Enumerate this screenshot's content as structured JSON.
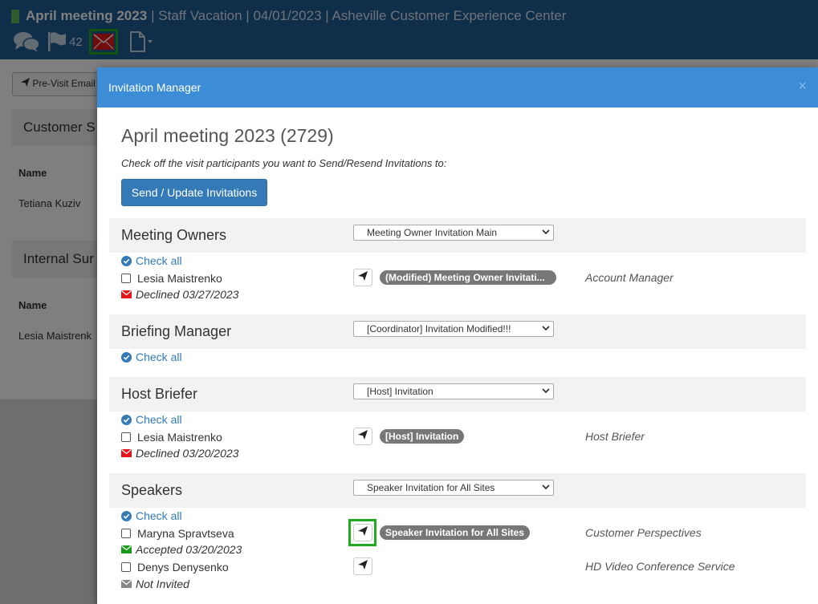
{
  "header": {
    "visit_name": "April meeting 2023",
    "visit_details": "| Staff Vacation | 04/01/2023 | Asheville Customer Experience Center",
    "flag_count": "42",
    "icons": [
      "comments-icon",
      "flag-icon",
      "envelope-icon",
      "file-icon"
    ]
  },
  "background": {
    "pre_visit_button": "Pre-Visit Email",
    "panel1_title": "Customer S",
    "panel2_title": "Internal Sur",
    "col_name_1": "Name",
    "row_1": "Tetiana Kuziv",
    "col_name_2": "Name",
    "row_2": "Lesia Maistrenk"
  },
  "modal": {
    "title": "Invitation Manager",
    "close": "×",
    "visit_title": "April meeting 2023 (2729)",
    "instructions": "Check off the visit participants you want to Send/Resend Invitations to:",
    "send_button": "Send / Update Invitations",
    "check_all_label": "Check all",
    "sections": [
      {
        "title": "Meeting Owners",
        "template": "Meeting Owner Invitation Main",
        "participants": [
          {
            "name": "Lesia Maistrenko",
            "status": "Declined 03/27/2023",
            "status_color": "#e4161a",
            "template_badge": "(Modified) Meeting Owner Invitati...",
            "role": "Account Manager"
          }
        ]
      },
      {
        "title": "Briefing Manager",
        "template": "[Coordinator] Invitation Modified!!!",
        "participants": []
      },
      {
        "title": "Host Briefer",
        "template": "[Host] Invitation",
        "participants": [
          {
            "name": "Lesia Maistrenko",
            "status": "Declined 03/20/2023",
            "status_color": "#e4161a",
            "template_badge": "[Host] Invitation",
            "role": "Host Briefer"
          }
        ]
      },
      {
        "title": "Speakers",
        "template": "Speaker Invitation for All Sites",
        "participants": [
          {
            "name": "Maryna Spravtseva",
            "status": "Accepted 03/20/2023",
            "status_color": "#1a9a1a",
            "template_badge": "Speaker Invitation for All Sites",
            "role": "Customer Perspectives"
          },
          {
            "name": "Denys Denysenko",
            "status": "Not Invited",
            "status_color": "#888888",
            "template_badge": "",
            "role": "HD Video Conference Service"
          }
        ]
      }
    ]
  },
  "colors": {
    "header_bg": "#1e5d95",
    "modal_header_bg": "#3c8dd6",
    "primary_button": "#337ab7",
    "highlight": "#1ea91e",
    "declined": "#e4161a",
    "accepted": "#1a9a1a"
  }
}
